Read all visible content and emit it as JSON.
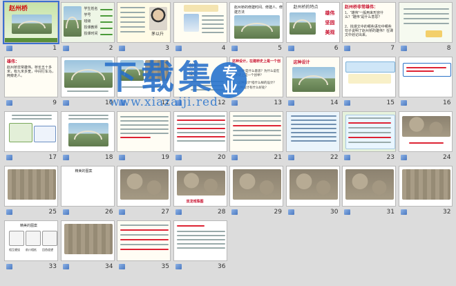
{
  "slides": [
    {
      "num": "1",
      "title": "赵州桥"
    },
    {
      "num": "2",
      "labels": [
        "学生姓名",
        "学号",
        "班级",
        "授课教师",
        "授课时间"
      ]
    },
    {
      "num": "3",
      "caption": "茅以升"
    },
    {
      "num": "4"
    },
    {
      "num": "5",
      "title": "赵州桥的修建时间、修建人、修建方法"
    },
    {
      "num": "6",
      "title": "赵州桥的特点",
      "tags": [
        "雄伟",
        "坚固",
        "美观"
      ]
    },
    {
      "num": "7",
      "title": "赵州桥非常雄伟：",
      "lines": [
        "1、“雄伟”一般用来形容什么？“雄伟”是什么意思？",
        "2、找课文中的哪些语句中哪些句子说明了赵州桥的雄伟？在课文中划记出来。"
      ]
    },
    {
      "num": "8"
    },
    {
      "num": "9",
      "title": "雄伟：",
      "text": "赵州桥非常雄伟。桥长五十多米，有九米多宽，中间行车马，两旁走人。"
    },
    {
      "num": "10"
    },
    {
      "num": "11"
    },
    {
      "num": "12",
      "lines": [
        "创举",
        "设计"
      ]
    },
    {
      "num": "13",
      "title": "这种设计，在建桥史上是一个创举",
      "lines": [
        "1、“创举”是什么意思？为什么说在建桥史上是一个创举？",
        "2、“这种设计”指什么样的设计？",
        "3、这种设计有什么好处？"
      ]
    },
    {
      "num": "14",
      "title": "这种设计"
    },
    {
      "num": "15"
    },
    {
      "num": "16"
    },
    {
      "num": "17"
    },
    {
      "num": "18"
    },
    {
      "num": "19"
    },
    {
      "num": "20"
    },
    {
      "num": "21",
      "lines": [
        "承接了上文",
        "这座桥不但坚固，而且美观",
        "开启了下文"
      ]
    },
    {
      "num": "22"
    },
    {
      "num": "23"
    },
    {
      "num": "24"
    },
    {
      "num": "25"
    },
    {
      "num": "26",
      "captions": [
        "相互缠绕",
        "前爪相抵",
        "回首遥望"
      ]
    },
    {
      "num": "27"
    },
    {
      "num": "28",
      "caption": "双龙戏珠图"
    },
    {
      "num": "29"
    },
    {
      "num": "30"
    },
    {
      "num": "31"
    },
    {
      "num": "32"
    },
    {
      "num": "33",
      "caption": "精美的图案"
    },
    {
      "num": "34"
    },
    {
      "num": "35"
    },
    {
      "num": "36"
    }
  ],
  "watermark": {
    "title": "下载集",
    "badge": "专业",
    "url": "www.xiazaiji.red"
  }
}
